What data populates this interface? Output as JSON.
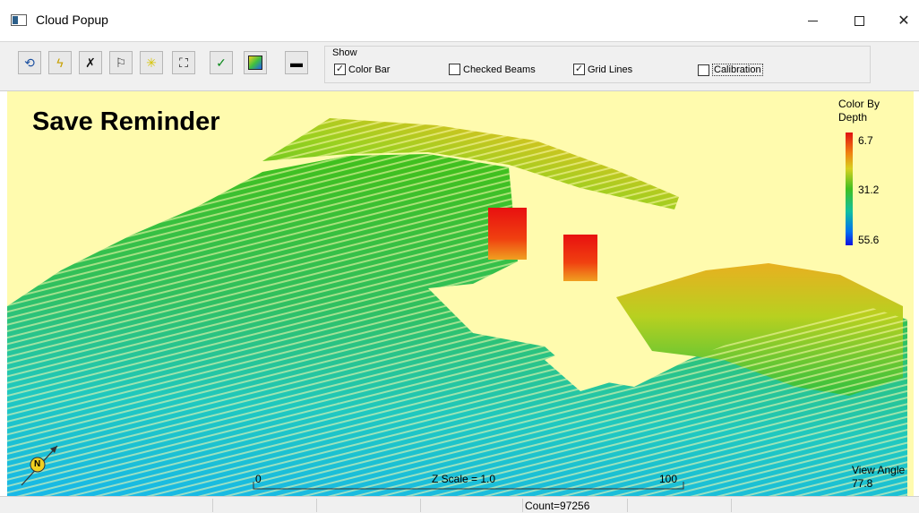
{
  "window": {
    "title": "Cloud Popup",
    "minimize_icon": "minimize-icon",
    "maximize_icon": "maximize-icon",
    "close_icon": "close-icon"
  },
  "toolbar": {
    "buttons": [
      {
        "name": "undo-view-button",
        "icon": "undo-view-icon",
        "glyph": "⟲",
        "color": "#1a4fa0"
      },
      {
        "name": "lightning-button",
        "icon": "lightning-icon",
        "glyph": "ϟ",
        "color": "#c8a000"
      },
      {
        "name": "delete-points-button",
        "icon": "x-icon",
        "glyph": "✗",
        "color": "#111111"
      },
      {
        "name": "flag-button",
        "icon": "flag-icon",
        "glyph": "⚐",
        "color": "#333333"
      },
      {
        "name": "highlight-button",
        "icon": "sparkle-icon",
        "glyph": "✳",
        "color": "#d6c400"
      },
      {
        "name": "fit-view-button",
        "icon": "fit-view-icon",
        "glyph": "⛶",
        "color": "#111111"
      },
      {
        "name": "accept-button",
        "icon": "check-icon",
        "glyph": "✓",
        "color": "#0c8a1c"
      },
      {
        "name": "color-mode-button",
        "icon": "color-gradient-icon",
        "glyph": "",
        "color": "#2a8ad8"
      },
      {
        "name": "hide-panel-button",
        "icon": "minus-box-icon",
        "glyph": "▬",
        "color": "#000000"
      }
    ],
    "show_group": {
      "label": "Show",
      "options": [
        {
          "label": "Color Bar",
          "checked": true
        },
        {
          "label": "Checked Beams",
          "checked": false
        },
        {
          "label": "Grid Lines",
          "checked": true
        },
        {
          "label": "Calibration",
          "checked": false
        }
      ]
    }
  },
  "viewport": {
    "overlay_text": "Save Reminder",
    "legend": {
      "title_line1": "Color By",
      "title_line2": "Depth",
      "values": [
        "6.7",
        "31.2",
        "55.6"
      ],
      "colors": {
        "shallow": "#e01010",
        "mid": "#40c020",
        "deep": "#1010e0"
      }
    },
    "view_angle_label": "View Angle",
    "view_angle_value": "77.8",
    "scale": {
      "start": "0",
      "label": "Z Scale = 1.0",
      "end": "100"
    },
    "north_label": "N",
    "background": "#fffbae"
  },
  "status": {
    "count_text": "Count=97256"
  }
}
